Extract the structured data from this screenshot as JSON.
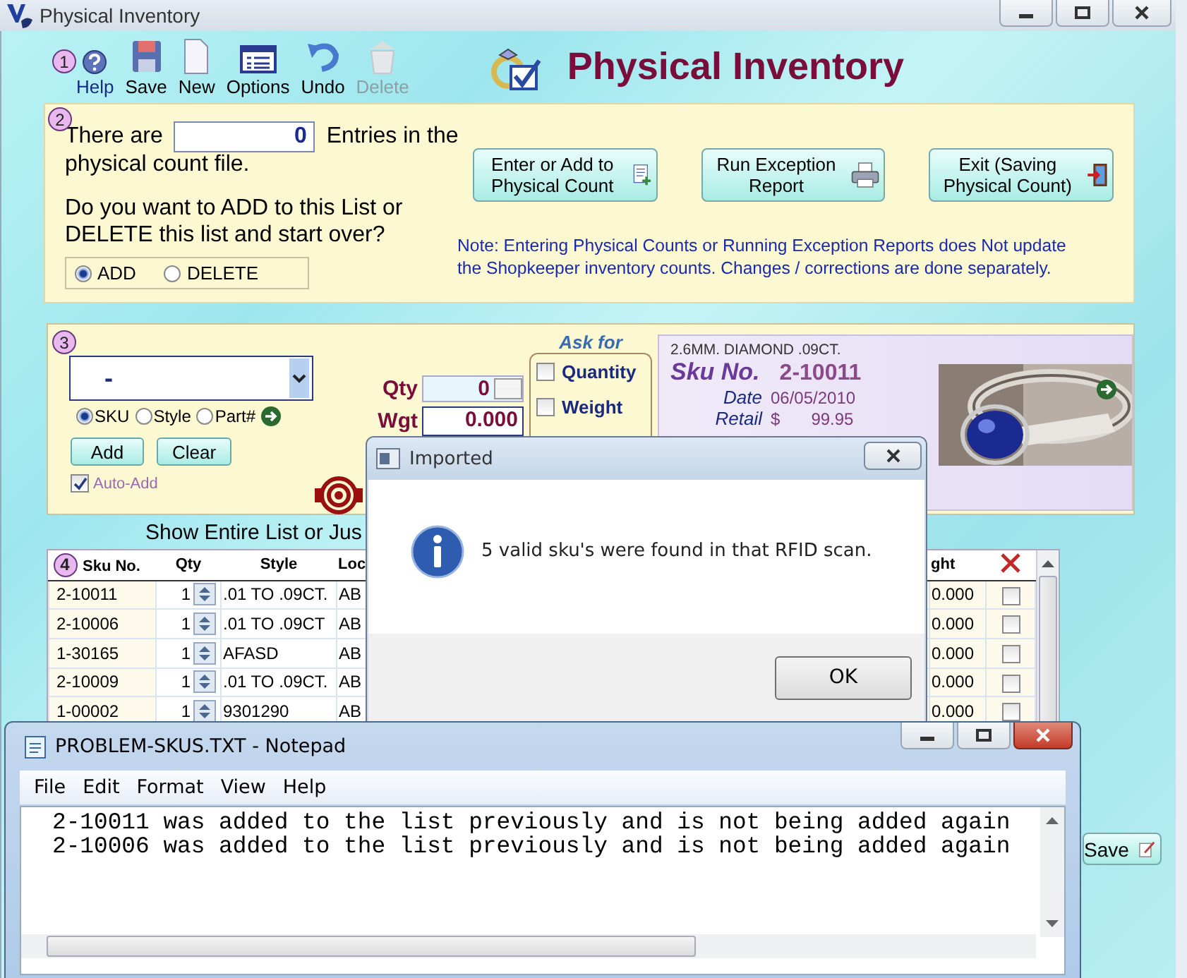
{
  "window": {
    "title": "Physical Inventory"
  },
  "toolbar": {
    "step": "1",
    "buttons": [
      {
        "label": "Help",
        "kind": "help",
        "disabled": false
      },
      {
        "label": "Save",
        "kind": "save",
        "disabled": false
      },
      {
        "label": "New",
        "kind": "new",
        "disabled": false
      },
      {
        "label": "Options",
        "kind": "options",
        "disabled": false
      },
      {
        "label": "Undo",
        "kind": "undo",
        "disabled": false
      },
      {
        "label": "Delete",
        "kind": "delete",
        "disabled": true
      }
    ]
  },
  "heading": "Physical Inventory",
  "count_section": {
    "step": "2",
    "prefix": "There are",
    "count": "0",
    "suffix": "Entries in the",
    "continuation": "physical count file.",
    "question": "Do you want to ADD to this List or DELETE this list and start over?",
    "options": [
      {
        "label": "ADD",
        "selected": true
      },
      {
        "label": "DELETE",
        "selected": false
      }
    ],
    "buttons": [
      {
        "label": "Enter or Add to Physical Count",
        "kind": "enter"
      },
      {
        "label": "Run Exception Report",
        "kind": "print"
      },
      {
        "label": "Exit (Saving Physical Count)",
        "kind": "exit"
      }
    ],
    "note": "Note: Entering Physical Counts or Running Exception Reports does Not  update\nthe Shopkeeper inventory counts. Changes / corrections are done separately."
  },
  "entry_section": {
    "step": "3",
    "sku_value": "-",
    "search_by": [
      {
        "label": "SKU",
        "selected": true
      },
      {
        "label": "Style",
        "selected": false
      },
      {
        "label": "Part#",
        "selected": false
      }
    ],
    "buttons": [
      "Add",
      "Clear"
    ],
    "auto_add": {
      "label": "Auto-Add",
      "checked": true
    },
    "qty_label": "Qty",
    "qty": "0",
    "wgt_label": "Wgt",
    "wgt": "0.000",
    "ask_for": {
      "title": "Ask for",
      "options": [
        {
          "label": "Quantity",
          "checked": false
        },
        {
          "label": "Weight",
          "checked": false
        }
      ]
    }
  },
  "item_card": {
    "description": "2.6MM. DIAMOND .09CT.",
    "sku_label": "Sku No.",
    "sku": "2-10011",
    "date_label": "Date",
    "date": "06/05/2010",
    "retail_label": "Retail",
    "currency": "$",
    "retail": "99.95"
  },
  "list_caption": "Show Entire List or Jus",
  "table": {
    "step": "4",
    "columns": [
      "Sku No.",
      "Qty",
      "Style",
      "Loc",
      "ght"
    ],
    "rows": [
      {
        "sku": "2-10011",
        "qty": "1",
        "style": ".01 TO .09CT.",
        "loc": "AB",
        "weight": "0.000",
        "delete": false
      },
      {
        "sku": "2-10006",
        "qty": "1",
        "style": ".01 TO .09CT",
        "loc": "AB",
        "weight": "0.000",
        "delete": false
      },
      {
        "sku": "1-30165",
        "qty": "1",
        "style": "AFASD",
        "loc": "AB",
        "weight": "0.000",
        "delete": false
      },
      {
        "sku": "2-10009",
        "qty": "1",
        "style": ".01 TO .09CT.",
        "loc": "AB",
        "weight": "0.000",
        "delete": false
      },
      {
        "sku": "1-00002",
        "qty": "1",
        "style": "9301290",
        "loc": "AB",
        "weight": "0.000",
        "delete": false
      }
    ]
  },
  "save_button": "Save",
  "dialog": {
    "title": "Imported",
    "message": "5 valid sku's were found in that RFID scan.",
    "button": "OK"
  },
  "notepad": {
    "title": "PROBLEM-SKUS.TXT - Notepad",
    "menu": [
      "File",
      "Edit",
      "Format",
      "View",
      "Help"
    ],
    "lines": [
      "2-10011 was added to the list previously and is not being added again",
      "2-10006 was added to the list previously and is not being added again"
    ]
  }
}
